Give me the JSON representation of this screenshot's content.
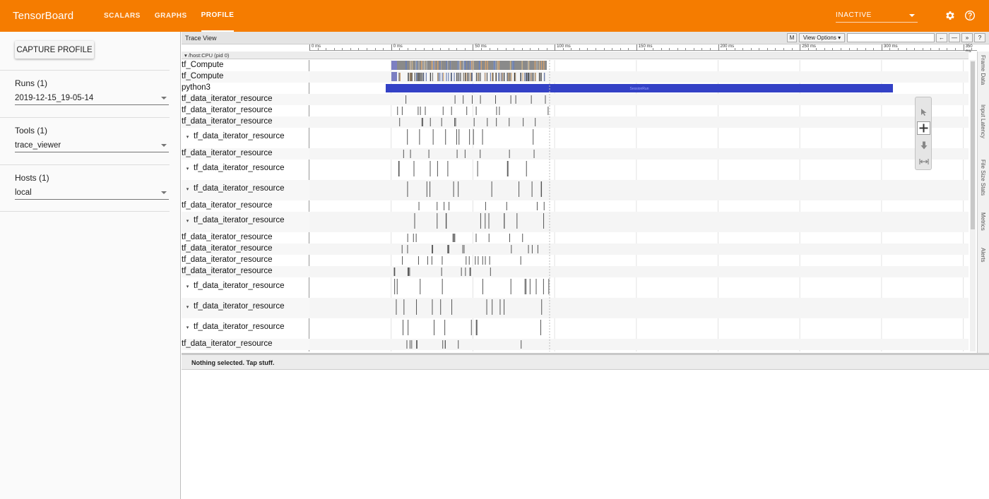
{
  "app": {
    "title": "TensorBoard",
    "tabs": [
      {
        "label": "SCALARS",
        "active": false
      },
      {
        "label": "GRAPHS",
        "active": false
      },
      {
        "label": "PROFILE",
        "active": true
      }
    ],
    "status": "INACTIVE",
    "colors": {
      "header": "#f57c00",
      "slice_blue": "#3341c6"
    }
  },
  "sidebar": {
    "capture_label": "CAPTURE PROFILE",
    "runs": {
      "label": "Runs (1)",
      "value": "2019-12-15_19-05-14"
    },
    "tools": {
      "label": "Tools (1)",
      "value": "trace_viewer"
    },
    "hosts": {
      "label": "Hosts (1)",
      "value": "local"
    }
  },
  "trace": {
    "title": "Trace View",
    "m_button": "M",
    "view_options": "View Options ▾",
    "nav_buttons": [
      "←",
      "—",
      "»",
      "?"
    ],
    "ruler": [
      {
        "label": "0 ms",
        "ms": 0
      },
      {
        "label": "0 ms",
        "ms": 50
      },
      {
        "label": "50 ms",
        "ms": 100
      },
      {
        "label": "100 ms",
        "ms": 150
      },
      {
        "label": "150 ms",
        "ms": 200
      },
      {
        "label": "200 ms",
        "ms": 250
      },
      {
        "label": "250 ms",
        "ms": 300
      },
      {
        "label": "300 ms",
        "ms": 350
      },
      {
        "label": "350 ms",
        "ms": 400
      }
    ],
    "process_header": "▾ /host:CPU (pid 0)",
    "tracks": [
      {
        "label": "tf_Compute",
        "expandable": false
      },
      {
        "label": "tf_Compute",
        "expandable": false
      },
      {
        "label": "python3",
        "expandable": false,
        "slice": "SessionRun"
      },
      {
        "label": "tf_data_iterator_resource",
        "expandable": false
      },
      {
        "label": "tf_data_iterator_resource",
        "expandable": false
      },
      {
        "label": "tf_data_iterator_resource",
        "expandable": false
      },
      {
        "label": "tf_data_iterator_resource",
        "expandable": true
      },
      {
        "label": "tf_data_iterator_resource",
        "expandable": false
      },
      {
        "label": "tf_data_iterator_resource",
        "expandable": true
      },
      {
        "label": "tf_data_iterator_resource",
        "expandable": true
      },
      {
        "label": "tf_data_iterator_resource",
        "expandable": false
      },
      {
        "label": "tf_data_iterator_resource",
        "expandable": true
      },
      {
        "label": "tf_data_iterator_resource",
        "expandable": false
      },
      {
        "label": "tf_data_iterator_resource",
        "expandable": false
      },
      {
        "label": "tf_data_iterator_resource",
        "expandable": false
      },
      {
        "label": "tf_data_iterator_resource",
        "expandable": false
      },
      {
        "label": "tf_data_iterator_resource",
        "expandable": true
      },
      {
        "label": "tf_data_iterator_resource",
        "expandable": true
      },
      {
        "label": "tf_data_iterator_resource",
        "expandable": true
      },
      {
        "label": "tf_data_iterator_resource",
        "expandable": false
      }
    ],
    "side_tabs": [
      "Frame Data",
      "Input Latency",
      "File Size Stats",
      "Metrics",
      "Alerts"
    ],
    "status": "Nothing selected. Tap stuff."
  }
}
